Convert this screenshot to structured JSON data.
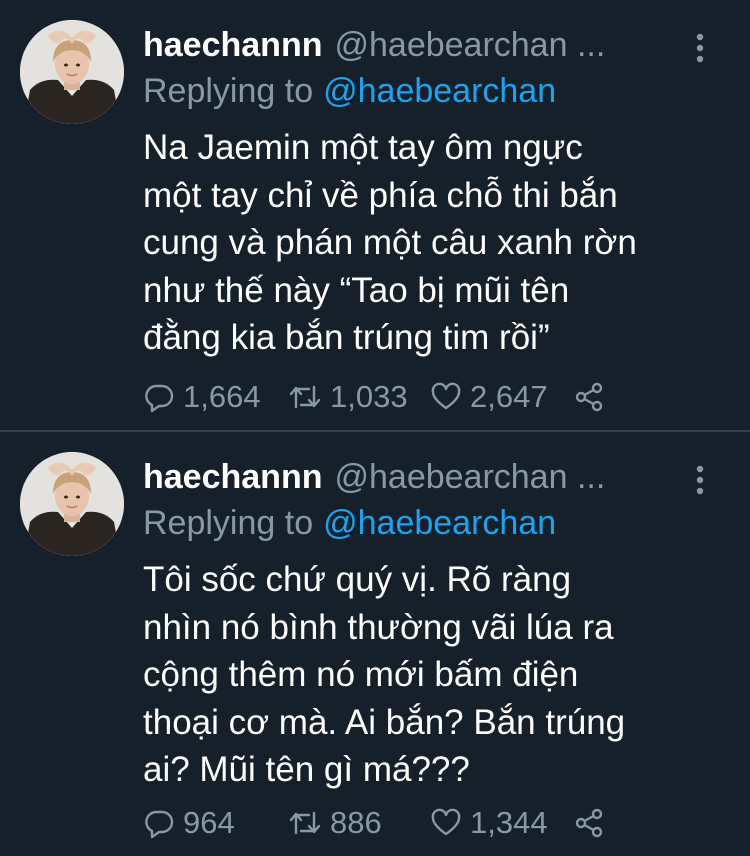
{
  "tweets": [
    {
      "display_name": "haechannn",
      "handle": "@haebearchan ...",
      "replying_prefix": "Replying to",
      "replying_handle": "@haebearchan",
      "body_lines": [
        "Na Jaemin một tay ôm ngực",
        "một tay chỉ về phía chỗ thi bắn",
        "cung và phán một câu xanh rờn",
        "như thế này “Tao bị mũi tên",
        "đằng kia bắn trúng tim rồi”"
      ],
      "replies": "1,664",
      "retweets": "1,033",
      "likes": "2,647"
    },
    {
      "display_name": "haechannn",
      "handle": "@haebearchan ...",
      "replying_prefix": "Replying to",
      "replying_handle": "@haebearchan",
      "body_lines": [
        "Tôi sốc chứ quý vị. Rõ ràng",
        "nhìn nó bình thường vãi lúa ra",
        "cộng thêm nó mới bấm điện",
        "thoại cơ mà. Ai bắn? Bắn trúng",
        "ai? Mũi tên gì má???"
      ],
      "replies": "964",
      "retweets": "886",
      "likes": "1,344"
    }
  ],
  "icons": {
    "reply": "reply-icon",
    "retweet": "retweet-icon",
    "like": "heart-icon",
    "share": "share-icon",
    "more": "more-vertical-icon"
  },
  "colors": {
    "background": "#15202b",
    "secondary_text": "#8899a6",
    "link": "#1da1f2",
    "divider": "#38444d"
  }
}
